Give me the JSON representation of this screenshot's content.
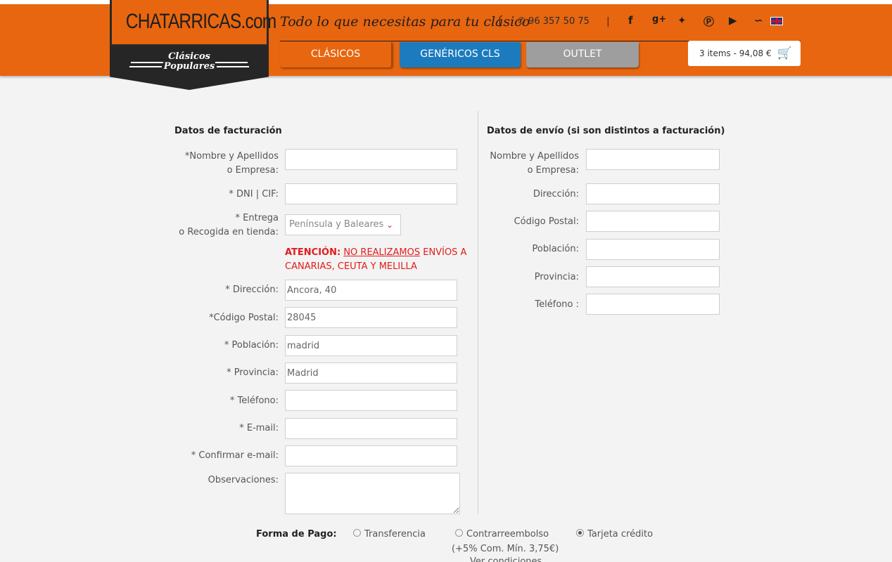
{
  "header": {
    "logo_text": "CHATARRICAS.com",
    "logo_sub_1": "Clásicos",
    "logo_sub_2": "Populares",
    "tagline": "Todo lo que necesitas para tu clásico",
    "phone": "96 357 50 75",
    "social_icons": [
      "facebook-icon",
      "google-plus-icon",
      "twitter-icon",
      "pinterest-icon",
      "youtube-icon",
      "rss-icon",
      "uk-flag-icon"
    ],
    "nav": [
      {
        "label": "CLÁSICOS",
        "color": "#e8660f"
      },
      {
        "label": "GENÉRICOS CLS",
        "color": "#1c7bbf"
      },
      {
        "label": "OUTLET",
        "color": "#9e9e9e"
      }
    ],
    "cart_label": "3 items - 94,08 €"
  },
  "billing": {
    "title": "Datos de facturación",
    "name_label_1": "*Nombre y Apellidos",
    "name_label_2": "o Empresa:",
    "dni_label": "* DNI | CIF:",
    "delivery_label_1": "* Entrega",
    "delivery_label_2": "o Recogida en tienda:",
    "delivery_value": "Península y Baleares",
    "warning_bold": "ATENCIÓN:",
    "warning_underline": "NO REALIZAMOS",
    "warning_rest_1": " ENVÍOS A",
    "warning_rest_2": "CANARIAS, CEUTA Y MELILLA",
    "address_label": "* Dirección:",
    "address_value": "Ancora, 40",
    "postal_label": "*Código Postal:",
    "postal_value": "28045",
    "city_label": "* Población:",
    "city_value": "madrid",
    "province_label": "* Provincia:",
    "province_value": "Madrid",
    "phone_label": "* Teléfono:",
    "email_label": "* E-mail:",
    "email_confirm_label": "* Confirmar e-mail:",
    "notes_label": "Observaciones:"
  },
  "shipping": {
    "title": "Datos de envío (si son distintos a facturación)",
    "name_label_1": "Nombre y Apellidos",
    "name_label_2": "o Empresa:",
    "address_label": "Dirección:",
    "postal_label": "Código Postal:",
    "city_label": "Población:",
    "province_label": "Provincia:",
    "phone_label": "Teléfono :"
  },
  "payment": {
    "title": "Forma de Pago:",
    "options": [
      {
        "label": "Transferencia",
        "selected": false
      },
      {
        "label": "Contrarreembolso",
        "selected": false
      },
      {
        "label": "Tarjeta crédito",
        "selected": true
      }
    ],
    "cod_note": "(+5% Com. Mín. 3,75€)",
    "cod_note_2": "Ver condiciones"
  }
}
